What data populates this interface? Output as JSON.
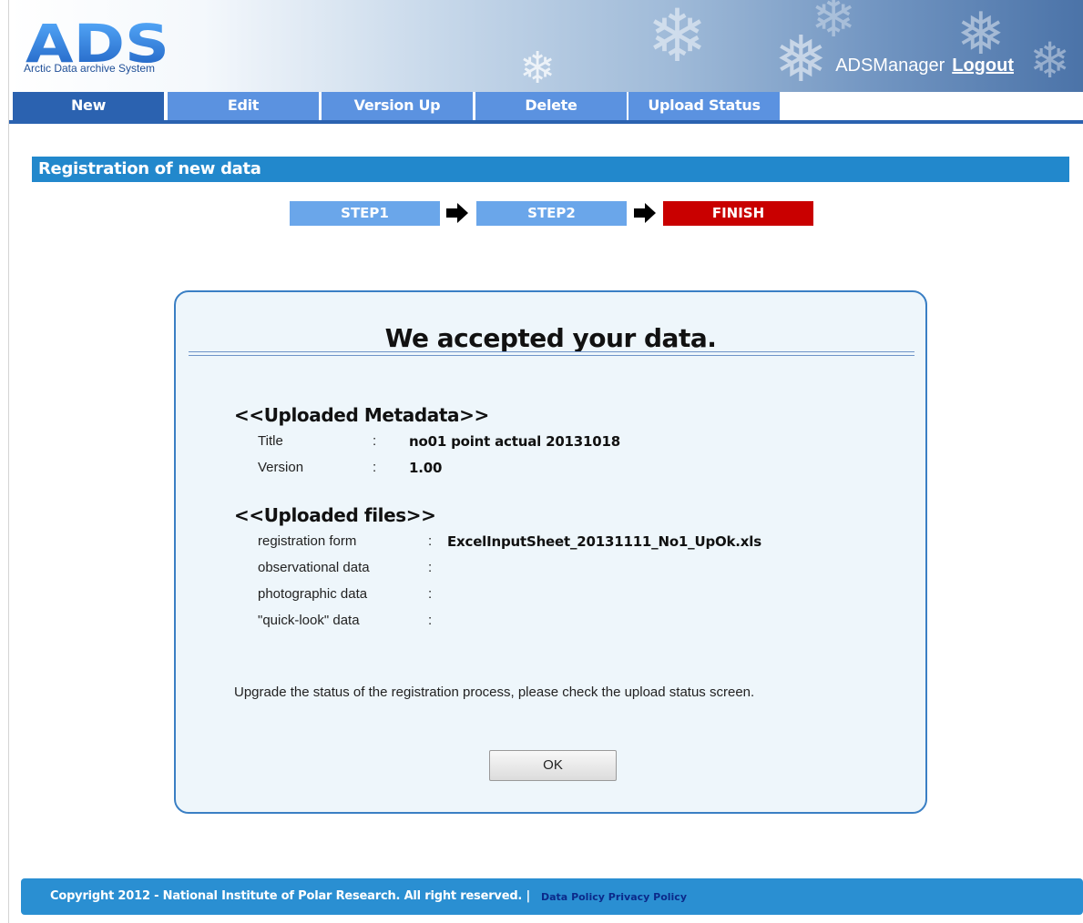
{
  "app": {
    "logo_text": "ADS",
    "logo_subtitle": "Arctic Data archive System",
    "username": "ADSManager",
    "logout_label": "Logout"
  },
  "tabs": [
    {
      "label": "New",
      "active": true
    },
    {
      "label": "Edit",
      "active": false
    },
    {
      "label": "Version Up",
      "active": false
    },
    {
      "label": "Delete",
      "active": false
    },
    {
      "label": "Upload Status",
      "active": false
    }
  ],
  "section": {
    "title": "Registration of new data"
  },
  "steps": [
    {
      "label": "STEP1",
      "color": "#6aa6ea"
    },
    {
      "label": "STEP2",
      "color": "#6aa6ea"
    },
    {
      "label": "FINISH",
      "color": "#c90000"
    }
  ],
  "panel": {
    "title": "We accepted your data.",
    "metadata_heading": "<<Uploaded Metadata>>",
    "metadata": [
      {
        "label": "Title",
        "value": "no01 point actual 20131018"
      },
      {
        "label": "Version",
        "value": "1.00"
      }
    ],
    "files_heading": "<<Uploaded files>>",
    "files": [
      {
        "label": "registration form",
        "value": "ExcelInputSheet_20131111_No1_UpOk.xls"
      },
      {
        "label": "observational data",
        "value": ""
      },
      {
        "label": "photographic data",
        "value": ""
      },
      {
        "label": "\"quick-look\" data",
        "value": ""
      }
    ],
    "separator": ":",
    "note": "Upgrade the status of the registration process, please check the upload status screen.",
    "ok_label": "OK"
  },
  "footer": {
    "copyright": "Copyright 2012 - National Institute of Polar Research. All right reserved. |",
    "links": [
      "Data Policy",
      "Privacy Policy"
    ]
  },
  "colors": {
    "accent": "#2288cc",
    "tab_active": "#2b62b0",
    "tab_inactive": "#5b92e0",
    "finish_red": "#c90000"
  }
}
